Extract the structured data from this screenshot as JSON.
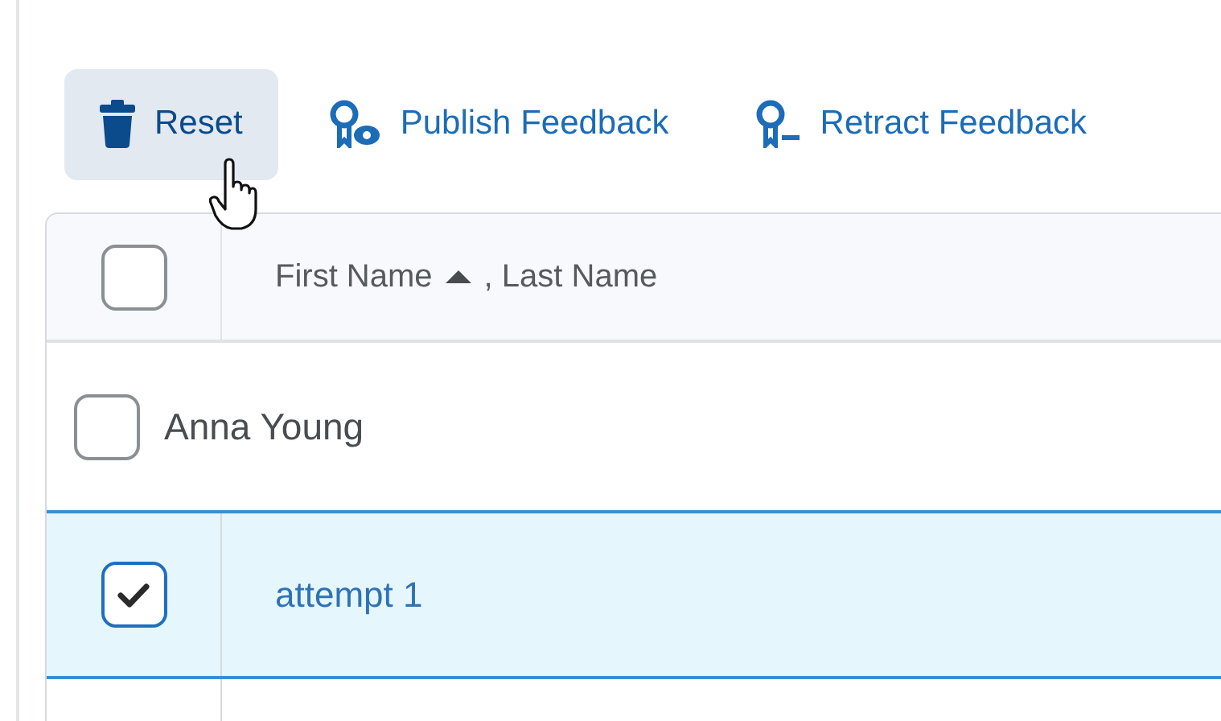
{
  "toolbar": [
    {
      "kind": "reset",
      "label": "Reset",
      "hovered": true
    },
    {
      "kind": "publish",
      "label": "Publish Feedback",
      "hovered": false
    },
    {
      "kind": "retract",
      "label": "Retract Feedback",
      "hovered": false
    }
  ],
  "table": {
    "header": {
      "checked": false,
      "first": "First Name",
      "separator": ", Last Name"
    },
    "rows": [
      {
        "kind": "group",
        "label": "Anna Young",
        "checked": false,
        "selected": false
      },
      {
        "kind": "attempt",
        "label": "attempt 1",
        "checked": true,
        "selected": true
      }
    ]
  }
}
